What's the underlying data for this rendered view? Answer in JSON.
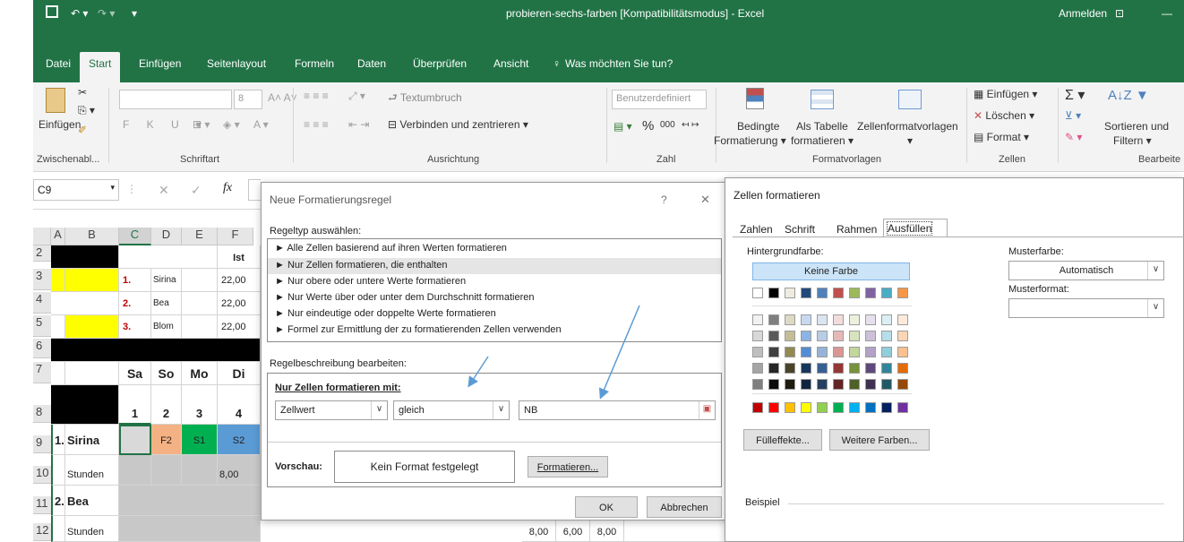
{
  "titlebar": {
    "file_title": "probieren-sechs-farben [Kompatibilitätsmodus] - Excel",
    "signin": "Anmelden"
  },
  "tabs": [
    "Datei",
    "Start",
    "Einfügen",
    "Seitenlayout",
    "Formeln",
    "Daten",
    "Überprüfen",
    "Ansicht"
  ],
  "tell_me": "Was möchten Sie tun?",
  "ribbon": {
    "paste": "Einfügen",
    "clipboard_group": "Zwischenabl...",
    "font_group": "Schriftart",
    "font_size": "8",
    "alignment_group": "Ausrichtung",
    "wrap_text": "Textumbruch",
    "merge_center": "Verbinden und zentrieren",
    "number_format": "Benutzerdefiniert",
    "number_group": "Zahl",
    "percent": "%",
    "thousands": "000",
    "cond_format": "Bedingte",
    "cond_format2": "Formatierung",
    "as_table": "Als Tabelle",
    "as_table2": "formatieren",
    "cell_styles": "Zellenformatvorlagen",
    "styles_group": "Formatvorlagen",
    "insert": "Einfügen",
    "delete": "Löschen",
    "format": "Format",
    "cells_group": "Zellen",
    "sort_filter": "Sortieren und",
    "sort_filter2": "Filtern",
    "editing_group": "Bearbeite"
  },
  "formula_bar": {
    "name_box": "C9",
    "fx": "fx"
  },
  "sheet": {
    "col_headers": [
      "A",
      "B",
      "C",
      "D",
      "E",
      "F"
    ],
    "row_headers": [
      "2",
      "3",
      "4",
      "5",
      "6",
      "7",
      "8",
      "9",
      "10",
      "11",
      "12"
    ],
    "cells": {
      "f2": "Ist",
      "c3": "1.",
      "d3": "Sirina",
      "f3": "22,00",
      "c4": "2.",
      "d4": "Bea",
      "f4": "22,00",
      "c5": "3.",
      "d5": "Blom",
      "f5": "22,00",
      "c7": "Sa",
      "d7": "So",
      "e7": "Mo",
      "f7": "Di",
      "c8": "1",
      "d8": "2",
      "e8": "3",
      "f8": "4",
      "a9": "1.",
      "b9": "Sirina",
      "d9": "F2",
      "e9": "S1",
      "f9": "S2",
      "b10": "Stunden",
      "f10": "8,00",
      "a11": "2.",
      "b11": "Bea",
      "b12": "Stunden",
      "r12a": "8,00",
      "r12b": "6,00",
      "r12c": "8,00"
    }
  },
  "rule_dialog": {
    "title": "Neue Formatierungsregel",
    "help": "?",
    "close": "✕",
    "select_type_label": "Regeltyp auswählen:",
    "rule_types": [
      "► Alle Zellen basierend auf ihren Werten formatieren",
      "► Nur Zellen formatieren, die enthalten",
      "► Nur obere oder untere Werte formatieren",
      "► Nur Werte über oder unter dem Durchschnitt formatieren",
      "► Nur eindeutige oder doppelte Werte formatieren",
      "► Formel zur Ermittlung der zu formatierenden Zellen verwenden"
    ],
    "edit_desc_label": "Regelbeschreibung bearbeiten:",
    "format_only_label": "Nur Zellen formatieren mit:",
    "condition1": "Zellwert",
    "condition2": "gleich",
    "value": "NB",
    "preview_label": "Vorschau:",
    "preview_text": "Kein Format festgelegt",
    "format_button": "Formatieren...",
    "ok": "OK",
    "cancel": "Abbrechen"
  },
  "format_dialog": {
    "title": "Zellen formatieren",
    "tabs": [
      "Zahlen",
      "Schrift",
      "Rahmen",
      "Ausfüllen"
    ],
    "bg_color_label": "Hintergrundfarbe:",
    "no_color": "Keine Farbe",
    "pattern_color_label": "Musterfarbe:",
    "pattern_color_value": "Automatisch",
    "pattern_style_label": "Musterformat:",
    "fill_effects": "Fülleffekte...",
    "more_colors": "Weitere Farben...",
    "sample_label": "Beispiel"
  },
  "colors": {
    "excel_green": "#217346",
    "yellow": "#ffff00",
    "orange_cell": "#f4b183",
    "green_cell": "#00b050",
    "blue_cell": "#5b9bd5",
    "arrow": "#5b9bd5"
  },
  "theme_row": [
    "#ffffff",
    "#000000",
    "#eeece1",
    "#1f497d",
    "#4f81bd",
    "#c0504d",
    "#9bbb59",
    "#8064a2",
    "#4bacc6",
    "#f79646"
  ],
  "tint_rows": [
    [
      "#f2f2f2",
      "#7f7f7f",
      "#ddd9c3",
      "#c6d9f0",
      "#dbe5f1",
      "#f2dcdb",
      "#ebf1dd",
      "#e5e0ec",
      "#dbeef3",
      "#fdeada"
    ],
    [
      "#d8d8d8",
      "#595959",
      "#c4bd97",
      "#8db3e2",
      "#b8cce4",
      "#e5b9b7",
      "#d7e3bc",
      "#ccc1d9",
      "#b7dde8",
      "#fbd5b5"
    ],
    [
      "#bfbfbf",
      "#3f3f3f",
      "#938953",
      "#548dd4",
      "#95b3d7",
      "#d99694",
      "#c3d69b",
      "#b2a2c7",
      "#92cddc",
      "#fac08f"
    ],
    [
      "#a5a5a5",
      "#262626",
      "#494429",
      "#17365d",
      "#366092",
      "#953734",
      "#76923c",
      "#5f497a",
      "#31859b",
      "#e36c09"
    ],
    [
      "#7f7f7f",
      "#0c0c0c",
      "#1d1b10",
      "#0f243e",
      "#244061",
      "#632423",
      "#4f6128",
      "#3f3151",
      "#205867",
      "#974806"
    ]
  ],
  "standard_row": [
    "#c00000",
    "#ff0000",
    "#ffc000",
    "#ffff00",
    "#92d050",
    "#00b050",
    "#00b0f0",
    "#0070c0",
    "#002060",
    "#7030a0"
  ]
}
